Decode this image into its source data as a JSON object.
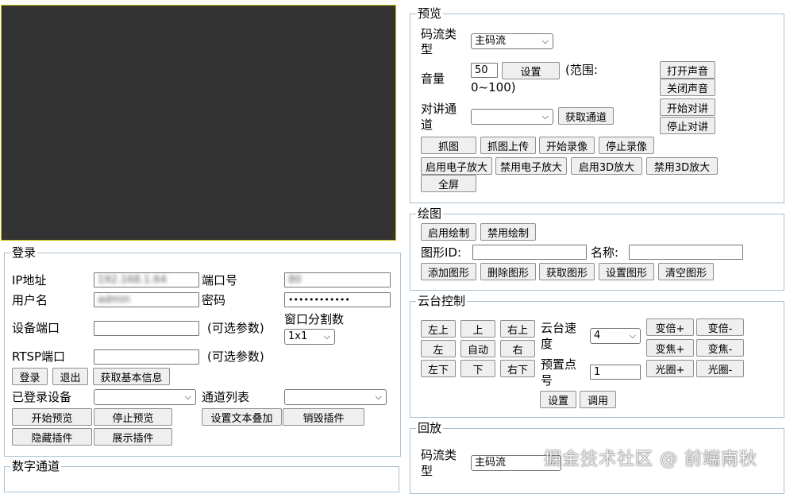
{
  "login": {
    "legend": "登录",
    "ip_label": "IP地址",
    "ip_value": "192.168.1.64",
    "port_label": "端口号",
    "port_value": "80",
    "user_label": "用户名",
    "user_value": "admin",
    "pwd_label": "密码",
    "pwd_value": "••••••••••••",
    "dev_port_label": "设备端口",
    "optional": "(可选参数)",
    "rtsp_label": "RTSP端口",
    "win_split_label": "窗口分割数",
    "win_split_value": "1x1",
    "btn_login": "登录",
    "btn_logout": "退出",
    "btn_get_info": "获取基本信息",
    "logged_devices_label": "已登录设备",
    "channel_list_label": "通道列表",
    "btn_start_preview": "开始预览",
    "btn_stop_preview": "停止预览",
    "btn_set_text_overlay": "设置文本叠加",
    "btn_destroy_plugin": "销毁插件",
    "btn_hide_plugin": "隐藏插件",
    "btn_show_plugin": "展示插件"
  },
  "digital_channel": {
    "legend": "数字通道"
  },
  "preview": {
    "legend": "预览",
    "stream_type_label_1": "码流类",
    "stream_type_label_2": "型",
    "stream_type_value": "主码流",
    "volume_label": "音量",
    "volume_value": "50",
    "btn_set": "设置",
    "range_1": "(范围:",
    "range_2": "0~100)",
    "btn_open_sound": "打开声音",
    "btn_close_sound": "关闭声音",
    "talk_channel_label_1": "对讲通",
    "talk_channel_label_2": "道",
    "btn_get_channel": "获取通道",
    "btn_start_talk": "开始对讲",
    "btn_stop_talk": "停止对讲",
    "btn_capture": "抓图",
    "btn_capture_upload": "抓图上传",
    "btn_start_record": "开始录像",
    "btn_stop_record": "停止录像",
    "btn_enable_ezoom": "启用电子放大",
    "btn_disable_ezoom": "禁用电子放大",
    "btn_enable_3d": "启用3D放大",
    "btn_disable_3d": "禁用3D放大",
    "btn_fullscreen": "全屏"
  },
  "drawing": {
    "legend": "绘图",
    "btn_enable_draw": "启用绘制",
    "btn_disable_draw": "禁用绘制",
    "shape_id_label": "图形ID:",
    "name_label": "名称:",
    "btn_add_shape": "添加图形",
    "btn_delete_shape": "删除图形",
    "btn_get_shape": "获取图形",
    "btn_set_shape": "设置图形",
    "btn_clear_shape": "清空图形"
  },
  "ptz": {
    "legend": "云台控制",
    "btn_up_left": "左上",
    "btn_up": "上",
    "btn_up_right": "右上",
    "btn_left": "左",
    "btn_auto": "自动",
    "btn_right": "右",
    "btn_down_left": "左下",
    "btn_down": "下",
    "btn_down_right": "右下",
    "speed_label_1": "云台速",
    "speed_label_2": "度",
    "speed_value": "4",
    "preset_label_1": "预置点",
    "preset_label_2": "号",
    "preset_value": "1",
    "btn_set": "设置",
    "btn_call": "调用",
    "btn_zoom_in": "变倍+",
    "btn_zoom_out": "变倍-",
    "btn_focus_in": "变焦+",
    "btn_focus_out": "变焦-",
    "btn_iris_in": "光圈+",
    "btn_iris_out": "光圈-"
  },
  "playback": {
    "legend": "回放",
    "stream_type_label_1": "码流类",
    "stream_type_label_2": "型",
    "stream_type_value": "主码流"
  },
  "watermark": "掘金技术社区 @ 前端南秋"
}
